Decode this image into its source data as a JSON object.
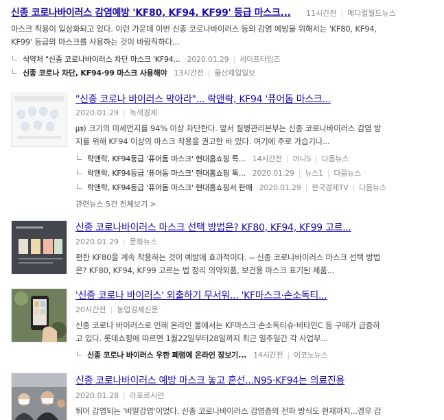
{
  "items": [
    {
      "title": "신종 코로나바이러스 감염예방 'KF80, KF94, KF99' 등급 마스크...",
      "time": "11시간전",
      "source": "메디컬월드뉴스",
      "desc1": "마스크 착용이 일상화되고 있다. 이런 가운데 이번 신종 코로나바이러스 등의 감염 예방을 위해서는 'KF80, KF94,",
      "desc2": "KF99' 등급의 마스크를 사용하는 것이 바람직하다...",
      "related": [
        {
          "title": "식약처 \"신종 코로나바이러스 차단 마스크 'KF94...",
          "date": "2020.01.29",
          "source": "세이프타임즈"
        },
        {
          "title": "신종 코로나 차단, KF94·99 마스크 사용해야",
          "date": "13시간전",
          "source": "울산제일일보"
        }
      ]
    },
    {
      "title": "\"신종 코로나 바이러스 막아라\"... 락앤락, KF94 '퓨어돔 마스크...",
      "date": "2020.01.29",
      "source": "녹색경제",
      "desc1": "㎛) 크기의 미세먼지를 94% 이상 차단한다. 앞서 질병관리본부는 신종 코로나바이러스 감염 방",
      "desc2": "지를 위해 KF94 이상의 마스크 착용을 권고한 바 있다. 여기에 주로 가습기나...",
      "related": [
        {
          "title": "락앤락, KF94등급 '퓨어돔 마스크' 현대홈쇼핑 특...",
          "date": "14시간전",
          "source1": "머니S",
          "source2": "다음뉴스"
        },
        {
          "title": "락앤락, KF94등급 '퓨어돔 마스크' 현대홈쇼핑 특...",
          "date": "2020.01.29",
          "source1": "뉴스1",
          "source2": "다음뉴스"
        },
        {
          "title": "락앤락, KF94등급 '퓨어돔 마스크' 현대홈쇼핑서 판매",
          "date": "2020.01.29",
          "source1": "한국경제TV",
          "source2": "다음뉴스"
        }
      ],
      "more": "관련뉴스 5건 전체보기 >"
    },
    {
      "title": "신종 코로나바이러스 마스크 선택 방법은? KF80, KF94, KF99 고르...",
      "date": "2020.01.29",
      "source": "문화뉴스",
      "desc1": "편한 KF80을 계속 착용하는 것이 예방에 효과적이다. -- 신종 코로나바이러스 마스크 선택 방법",
      "desc2": "은? KF80, KF94, KF99 고르는 법 정리 의약외품, 보건용 마스크 표기된 제품..."
    },
    {
      "title": "'신종 코로나 바이러스' 외출하기 무서워... 'KF마스크·손소독티...",
      "time": "20시간전",
      "source": "농업경제신문",
      "desc1": "신종 코로나 바이러스로 인해 온라인 몰에서는 KF마스크·손소독티슈·비타민C 등 구매가 급증하",
      "desc2": "고 있다. 롯데쇼핑에 따르면 1월22일부터28일까지 최근 일주일간 각 사업부...",
      "related": [
        {
          "title": "신종 코로나 바이러스 우한 폐렴에 온라인 장보기...",
          "date": "14시간전",
          "source": "이코노뉴스"
        }
      ]
    },
    {
      "title": "신종 코로나바이러스 예방 마스크 놓고 혼선...N95·KF94는 의료진용",
      "date": "2020.01.28",
      "source": "라포르시안",
      "desc1": "튀어 감염되는 '비말감염'이었다. 신종 코로나바이러스 감염증의 전파 방식도 현재까지...경우 감"
    }
  ]
}
